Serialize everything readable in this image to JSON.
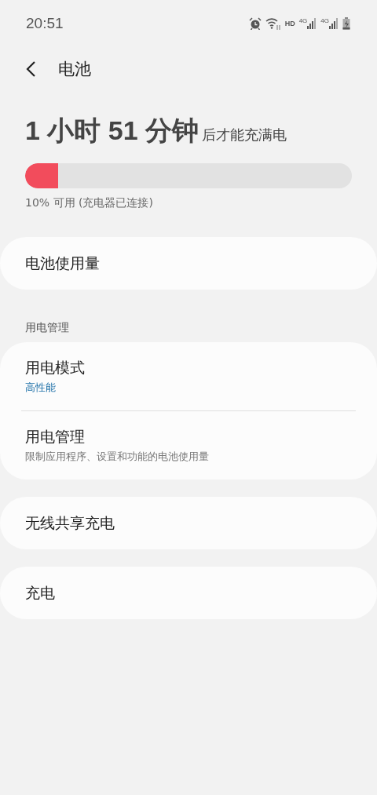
{
  "status_bar": {
    "time": "20:51",
    "hd": "HD",
    "sims": [
      {
        "label": "4G"
      },
      {
        "label": "4G"
      }
    ]
  },
  "header": {
    "title": "电池"
  },
  "charge": {
    "time_big": "1 小时 51 分钟",
    "time_suffix": "后才能充满电",
    "level": 0.1,
    "status": "10% 可用 (充电器已连接)"
  },
  "groups": [
    {
      "rows": [
        {
          "title": "电池使用量"
        }
      ]
    },
    {
      "heading": "用电管理",
      "rows": [
        {
          "title": "用电模式",
          "value": "高性能"
        },
        {
          "title": "用电管理",
          "summary": "限制应用程序、设置和功能的电池使用量"
        }
      ]
    },
    {
      "rows": [
        {
          "title": "无线共享充电"
        }
      ]
    },
    {
      "rows": [
        {
          "title": "充电"
        }
      ]
    }
  ]
}
